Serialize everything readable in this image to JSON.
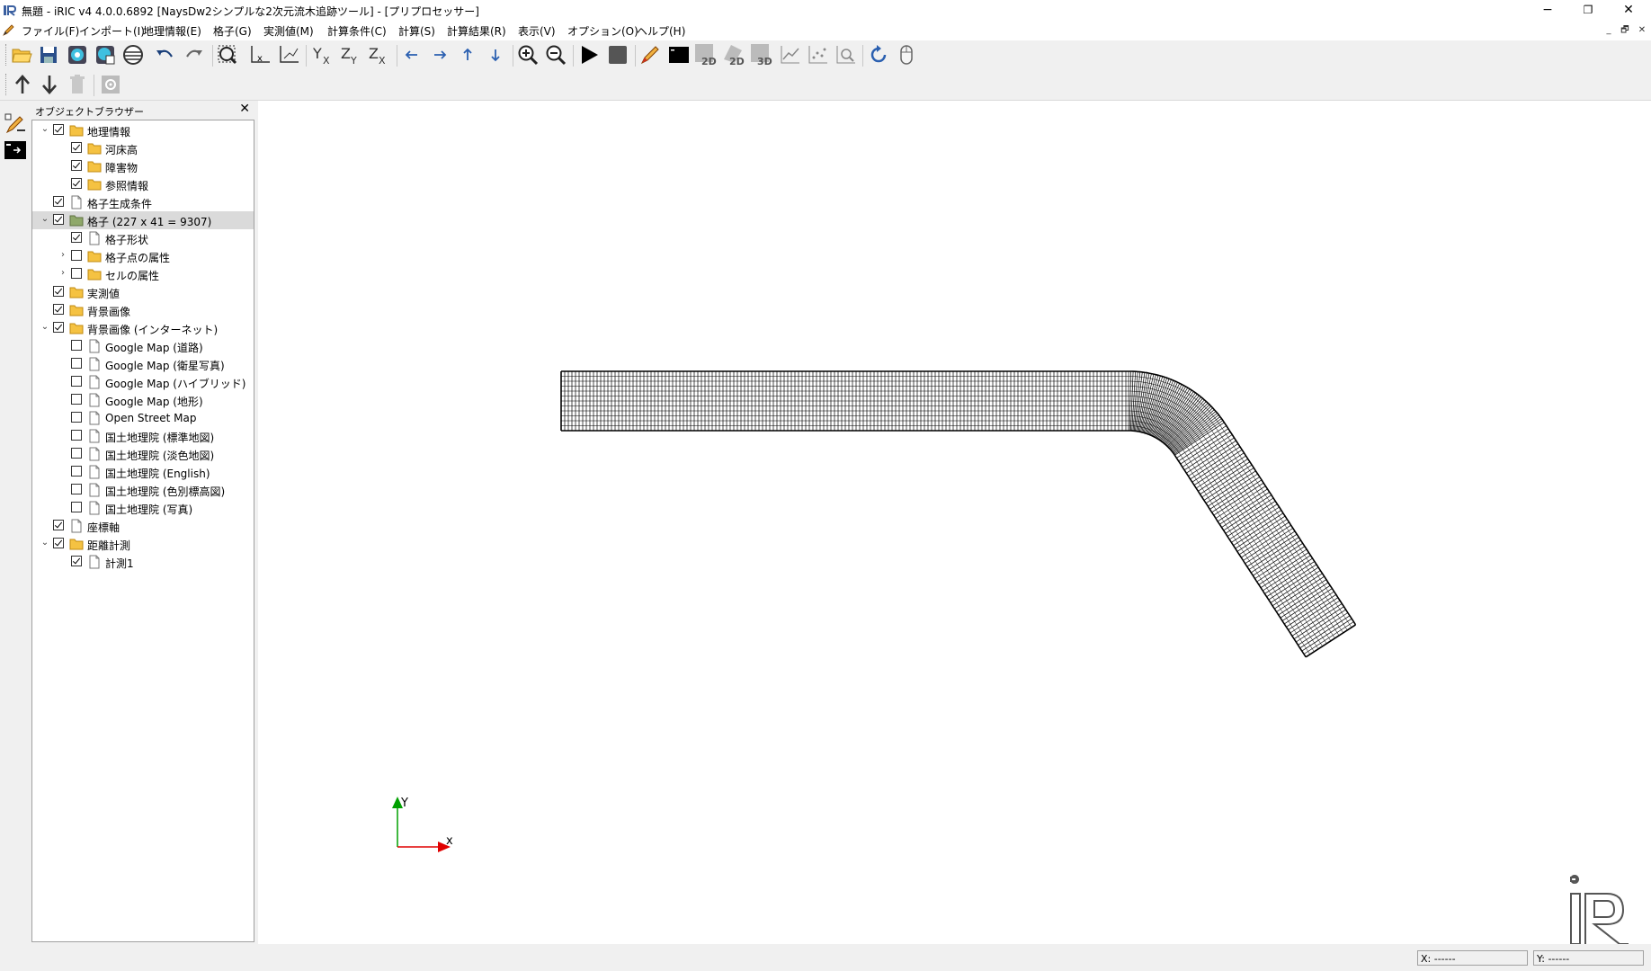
{
  "window": {
    "title": "無題 - iRIC v4 4.0.0.6892 [NaysDw2シンプルな2次元流木追跡ツール] - [プリプロセッサー]",
    "minimize": "−",
    "maximize": "❐",
    "close": "✕"
  },
  "menu": [
    "ファイル(F)",
    "インポート(I)",
    "地理情報(E)",
    "格子(G)",
    "実測値(M)",
    "計算条件(C)",
    "計算(S)",
    "計算結果(R)",
    "表示(V)",
    "オプション(O)",
    "ヘルプ(H)"
  ],
  "mdi": {
    "minimize": "_",
    "restore": "🗗",
    "close": "✕"
  },
  "object_browser": {
    "title": "オブジェクトブラウザー",
    "close": "✕",
    "items": [
      {
        "label": "地理情報",
        "level": 0,
        "expander": "open",
        "checked": true,
        "icon": "folder"
      },
      {
        "label": "河床高",
        "level": 1,
        "expander": "none",
        "checked": true,
        "icon": "folder"
      },
      {
        "label": "障害物",
        "level": 1,
        "expander": "none",
        "checked": true,
        "icon": "folder"
      },
      {
        "label": "参照情報",
        "level": 1,
        "expander": "none",
        "checked": true,
        "icon": "folder"
      },
      {
        "label": "格子生成条件",
        "level": 0,
        "expander": "none",
        "checked": true,
        "icon": "file"
      },
      {
        "label": "格子 (227 x 41 = 9307)",
        "level": 0,
        "expander": "open",
        "checked": true,
        "icon": "folder-green",
        "selected": true
      },
      {
        "label": "格子形状",
        "level": 1,
        "expander": "none",
        "checked": true,
        "icon": "file"
      },
      {
        "label": "格子点の属性",
        "level": 1,
        "expander": "closed",
        "checked": false,
        "icon": "folder"
      },
      {
        "label": "セルの属性",
        "level": 1,
        "expander": "closed",
        "checked": false,
        "icon": "folder"
      },
      {
        "label": "実測値",
        "level": 0,
        "expander": "none",
        "checked": true,
        "icon": "folder"
      },
      {
        "label": "背景画像",
        "level": 0,
        "expander": "none",
        "checked": true,
        "icon": "folder"
      },
      {
        "label": "背景画像 (インターネット)",
        "level": 0,
        "expander": "open",
        "checked": true,
        "icon": "folder"
      },
      {
        "label": "Google Map (道路)",
        "level": 1,
        "expander": "none",
        "checked": false,
        "icon": "file"
      },
      {
        "label": "Google Map (衛星写真)",
        "level": 1,
        "expander": "none",
        "checked": false,
        "icon": "file"
      },
      {
        "label": "Google Map (ハイブリッド)",
        "level": 1,
        "expander": "none",
        "checked": false,
        "icon": "file"
      },
      {
        "label": "Google Map (地形)",
        "level": 1,
        "expander": "none",
        "checked": false,
        "icon": "file"
      },
      {
        "label": "Open Street Map",
        "level": 1,
        "expander": "none",
        "checked": false,
        "icon": "file"
      },
      {
        "label": "国土地理院 (標準地図)",
        "level": 1,
        "expander": "none",
        "checked": false,
        "icon": "file"
      },
      {
        "label": "国土地理院 (淡色地図)",
        "level": 1,
        "expander": "none",
        "checked": false,
        "icon": "file"
      },
      {
        "label": "国土地理院 (English)",
        "level": 1,
        "expander": "none",
        "checked": false,
        "icon": "file"
      },
      {
        "label": "国土地理院 (色別標高図)",
        "level": 1,
        "expander": "none",
        "checked": false,
        "icon": "file"
      },
      {
        "label": "国土地理院 (写真)",
        "level": 1,
        "expander": "none",
        "checked": false,
        "icon": "file"
      },
      {
        "label": "座標軸",
        "level": 0,
        "expander": "none",
        "checked": true,
        "icon": "file"
      },
      {
        "label": "距離計測",
        "level": 0,
        "expander": "open",
        "checked": true,
        "icon": "folder"
      },
      {
        "label": "計測1",
        "level": 1,
        "expander": "none",
        "checked": true,
        "icon": "file"
      }
    ]
  },
  "axes_widget": {
    "x_label": "x",
    "y_label": "Y"
  },
  "status": {
    "x": "X: ------",
    "y": "Y: ------"
  },
  "colors": {
    "axis_x": "#e00000",
    "axis_y": "#00a000",
    "selection": "#dadada",
    "folder": "#f5c242"
  }
}
